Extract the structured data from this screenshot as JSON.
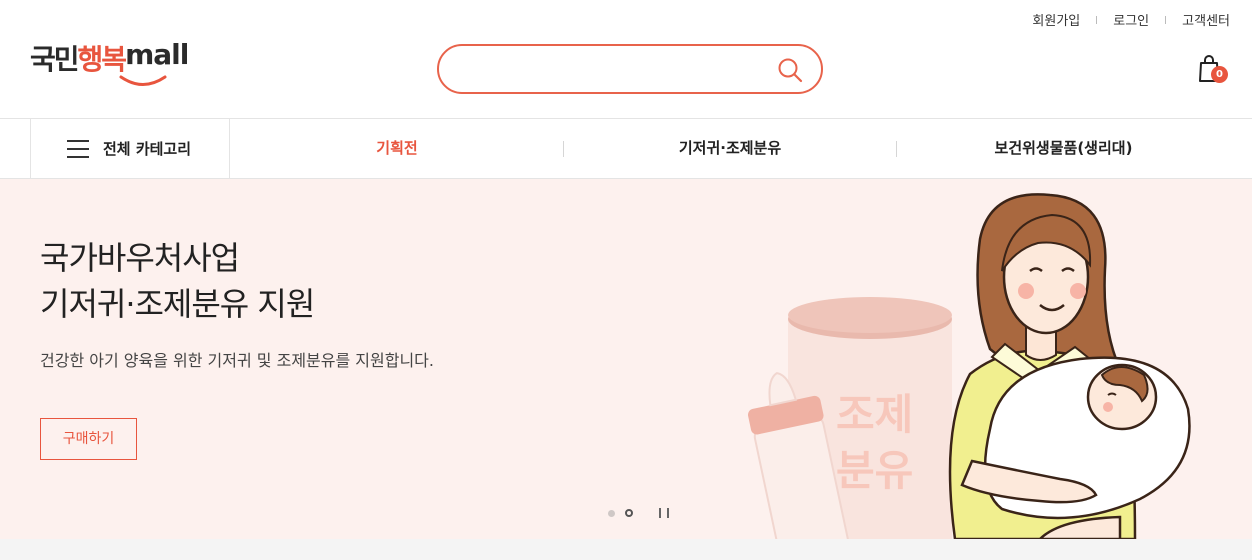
{
  "header": {
    "top_links": [
      "회원가입",
      "로그인",
      "고객센터"
    ],
    "logo": {
      "part1": "국민",
      "part2": "행복",
      "part3": "mall"
    },
    "search": {
      "placeholder": "",
      "value": ""
    },
    "cart_count": "0"
  },
  "nav": {
    "all_categories": "전체 카테고리",
    "items": [
      "기획전",
      "기저귀·조제분유",
      "보건위생물품(생리대)"
    ],
    "active_index": 0
  },
  "banner": {
    "title_line1": "국가바우처사업",
    "title_line2": "기저귀·조제분유 지원",
    "description": "건강한 아기 양육을 위한 기저귀 및 조제분유를 지원합니다.",
    "button_label": "구매하기",
    "can_label_line1": "조제",
    "can_label_line2": "분유",
    "slide_count": 2,
    "active_slide": 1
  },
  "colors": {
    "accent": "#e8553e",
    "banner_bg": "#fdf1ee"
  }
}
